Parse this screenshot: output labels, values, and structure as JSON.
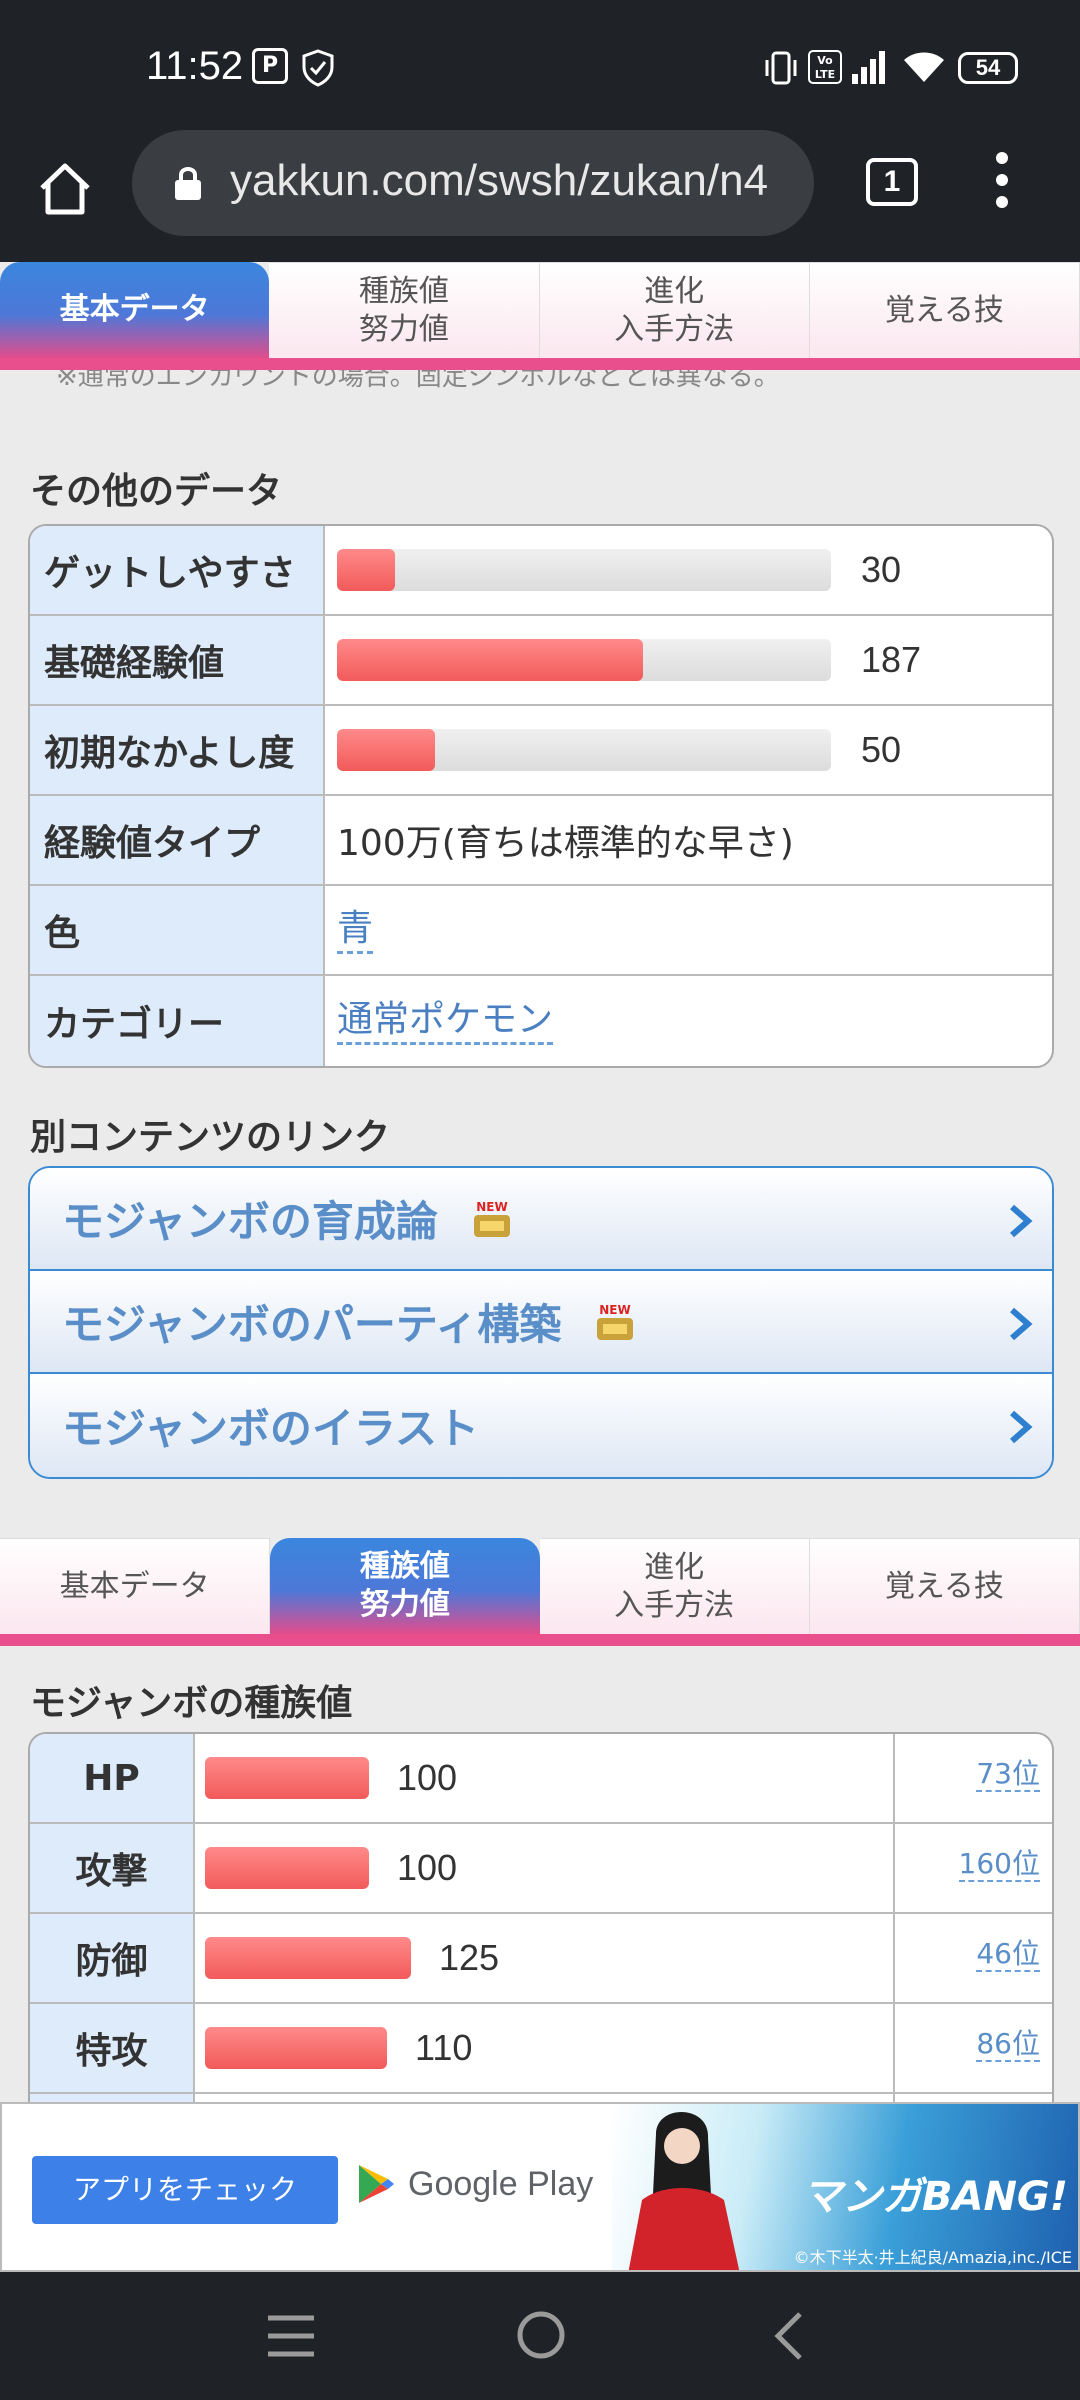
{
  "status_bar": {
    "time": "11:52",
    "volte": "Vo LTE",
    "battery": "54"
  },
  "browser": {
    "url": "yakkun.com/swsh/zukan/n4",
    "tab_count": "1"
  },
  "tabs_top": [
    {
      "label": "基本データ",
      "active": true
    },
    {
      "label": "種族値\n努力値",
      "active": false
    },
    {
      "label": "進化\n入手方法",
      "active": false
    },
    {
      "label": "覚える技",
      "active": false
    }
  ],
  "note": "※通常のエンカウントの場合。固定シンボルなどとは異なる。",
  "other_data": {
    "title": "その他のデータ",
    "rows": [
      {
        "label": "ゲットしやすさ",
        "value": "30",
        "fraction": 0.118
      },
      {
        "label": "基礎経験値",
        "value": "187",
        "fraction": 0.62
      },
      {
        "label": "初期なかよし度",
        "value": "50",
        "fraction": 0.196
      },
      {
        "label": "経験値タイプ",
        "text": "100万(育ちは標準的な早さ)"
      },
      {
        "label": "色",
        "link": "青"
      },
      {
        "label": "カテゴリー",
        "link": "通常ポケモン"
      }
    ]
  },
  "links": {
    "title": "別コンテンツのリンク",
    "items": [
      {
        "label": "モジャンボの育成論",
        "new": true
      },
      {
        "label": "モジャンボのパーティ構築",
        "new": true
      },
      {
        "label": "モジャンボのイラスト",
        "new": false
      }
    ],
    "new_badge": "NEW"
  },
  "tabs_mid": [
    {
      "label": "基本データ",
      "active": false
    },
    {
      "label": "種族値\n努力値",
      "active": true
    },
    {
      "label": "進化\n入手方法",
      "active": false
    },
    {
      "label": "覚える技",
      "active": false
    }
  ],
  "base_stats": {
    "title": "モジャンボの種族値",
    "rows": [
      {
        "label": "HP",
        "value": "100",
        "rank": "73位"
      },
      {
        "label": "攻撃",
        "value": "100",
        "rank": "160位"
      },
      {
        "label": "防御",
        "value": "125",
        "rank": "46位"
      },
      {
        "label": "特攻",
        "value": "110",
        "rank": "86位"
      }
    ]
  },
  "ad": {
    "button": "アプリをチェック",
    "store": "Google Play",
    "brand": "マンガBANG!",
    "credit": "©木下半太·井上紀良/Amazia,inc./ICE"
  },
  "colors": {
    "accent_blue": "#3a86de",
    "accent_pink": "#e84f8c",
    "bar_red": "#f25a5a"
  }
}
